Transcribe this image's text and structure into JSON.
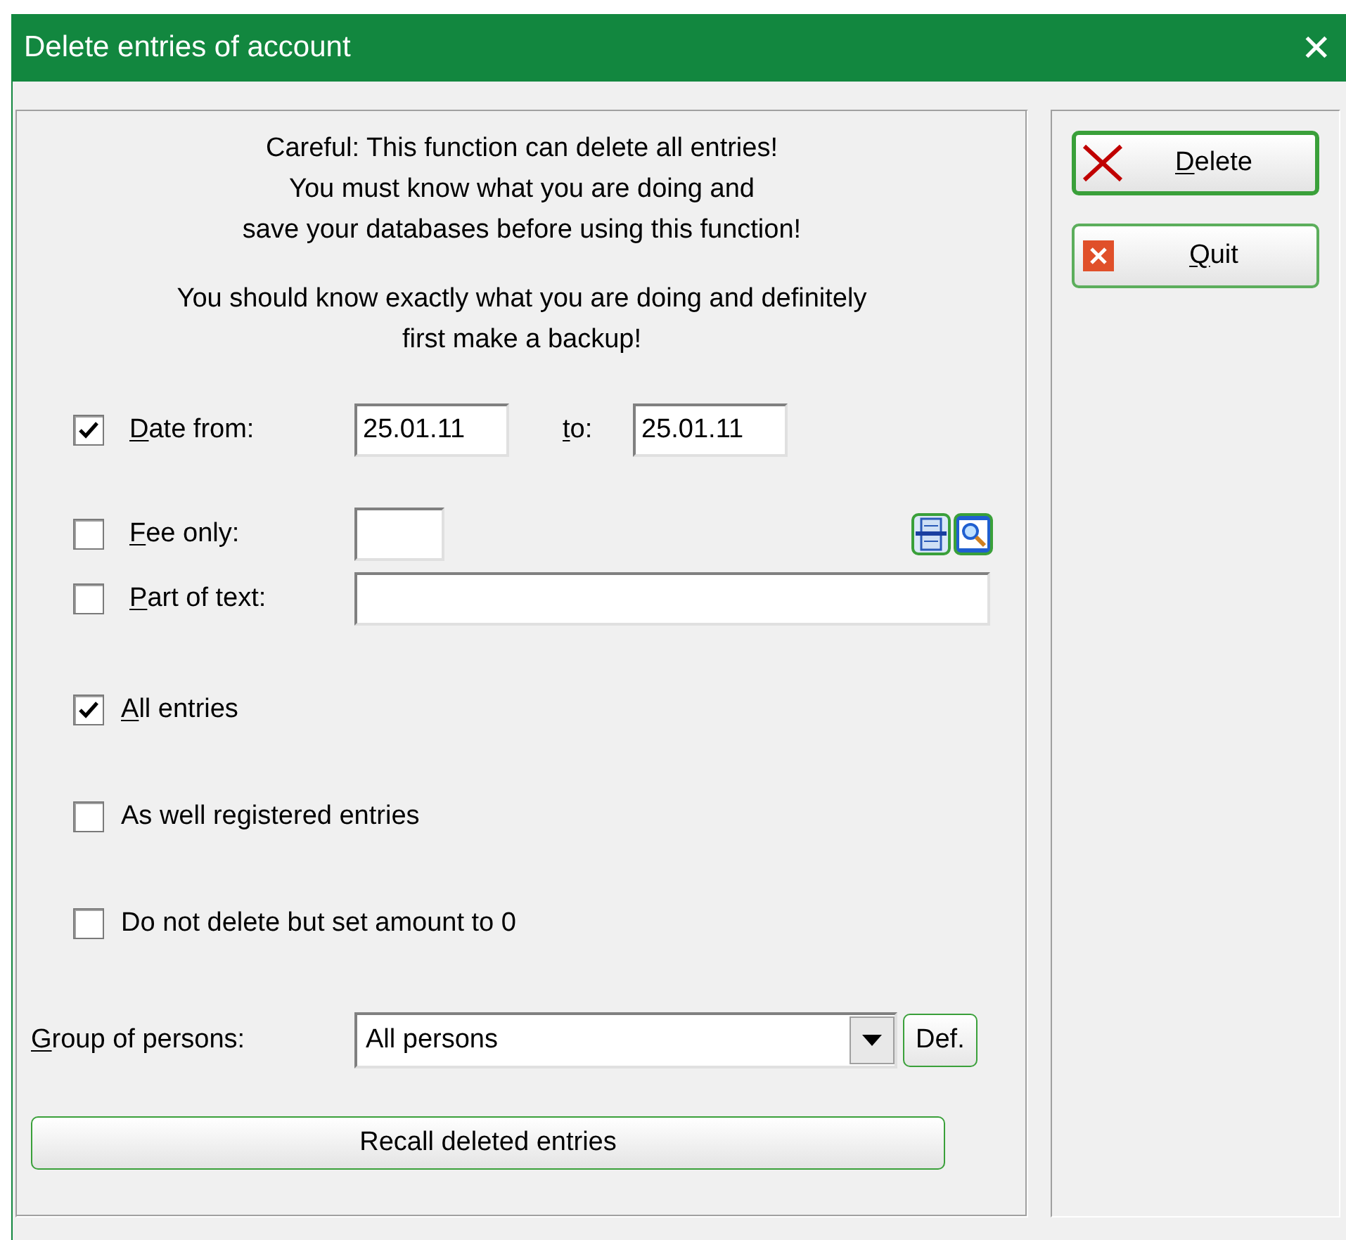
{
  "window": {
    "title": "Delete entries of account",
    "close": "✕"
  },
  "warning": [
    "Careful: This function can delete all entries!",
    "You must know what you are doing and",
    "save your databases before using this function!"
  ],
  "advice": [
    "You should know exactly what you are doing and definitely",
    "first make a backup!"
  ],
  "date_range": {
    "label": "Date from:",
    "underlined_key": true,
    "checked": true,
    "from": "25.01.11",
    "to_label": "to:",
    "to": "25.01.11"
  },
  "fee_only": {
    "label": "Fee only:",
    "underlined_key": true,
    "checked": false
  },
  "part_of_text": {
    "label": "Part of text:",
    "underlined_key": true,
    "checked": false
  },
  "options": [
    {
      "label": "All entries",
      "underlined_key": true,
      "checked": true
    },
    {
      "label": "As well registered entries",
      "underlined_key": false,
      "checked": false
    },
    {
      "label": "Do not delete but set amount to 0",
      "underlined_key": false,
      "checked": false
    }
  ],
  "group": {
    "label": "Group of persons:",
    "underlined_key": true,
    "value": "All persons",
    "def_button": "Def."
  },
  "recall_button": "Recall deleted entries",
  "actions": [
    {
      "kind": "delete",
      "label": "Delete",
      "underlined_key": true,
      "default": true
    },
    {
      "kind": "quit",
      "label": "Quit",
      "underlined_key": true,
      "default": false
    }
  ]
}
